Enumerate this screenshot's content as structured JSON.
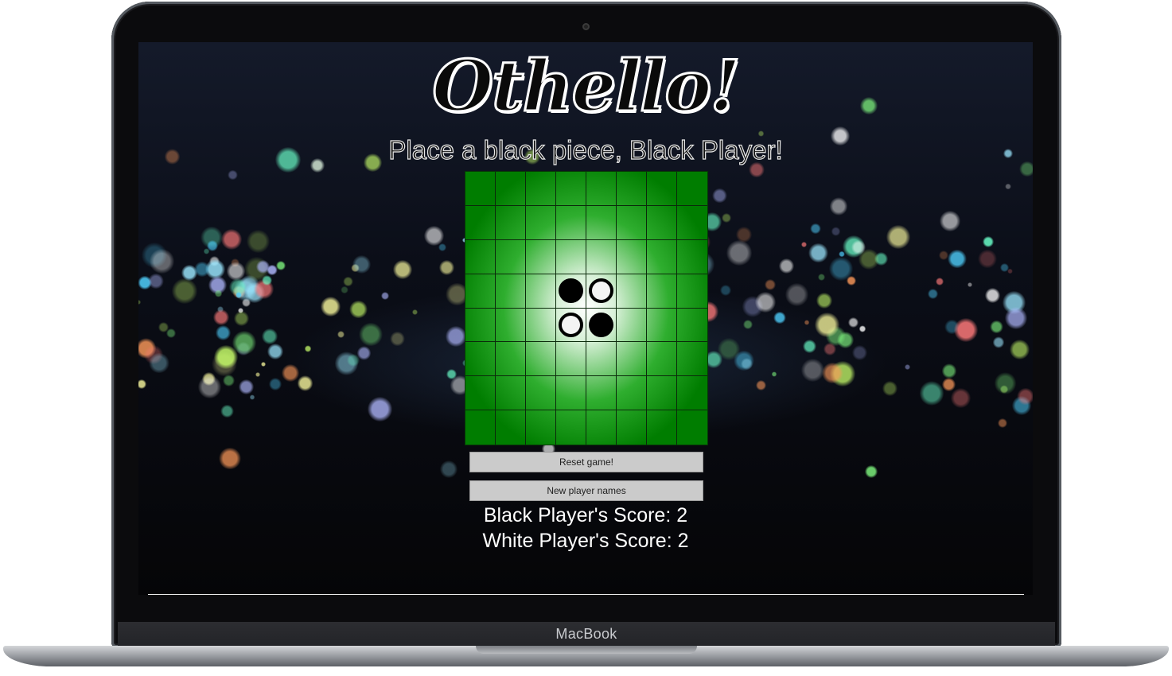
{
  "device": {
    "brand_label": "MacBook"
  },
  "game": {
    "title": "Othello!",
    "prompt": "Place a black piece, Black Player!",
    "board": {
      "rows": [
        [
          "",
          "",
          "",
          "",
          "",
          "",
          "",
          ""
        ],
        [
          "",
          "",
          "",
          "",
          "",
          "",
          "",
          ""
        ],
        [
          "",
          "",
          "",
          "",
          "",
          "",
          "",
          ""
        ],
        [
          "",
          "",
          "",
          "black",
          "white",
          "",
          "",
          ""
        ],
        [
          "",
          "",
          "",
          "white",
          "black",
          "",
          "",
          ""
        ],
        [
          "",
          "",
          "",
          "",
          "",
          "",
          "",
          ""
        ],
        [
          "",
          "",
          "",
          "",
          "",
          "",
          "",
          ""
        ],
        [
          "",
          "",
          "",
          "",
          "",
          "",
          "",
          ""
        ]
      ]
    },
    "buttons": {
      "reset_label": "Reset game!",
      "new_names_label": "New player names"
    },
    "scores": {
      "black_text": "Black Player's Score: 2",
      "white_text": "White Player's Score: 2"
    }
  },
  "colors": {
    "board_green": "#007d00",
    "button_gray": "#cbcbcb",
    "score_text": "#ffffff"
  }
}
